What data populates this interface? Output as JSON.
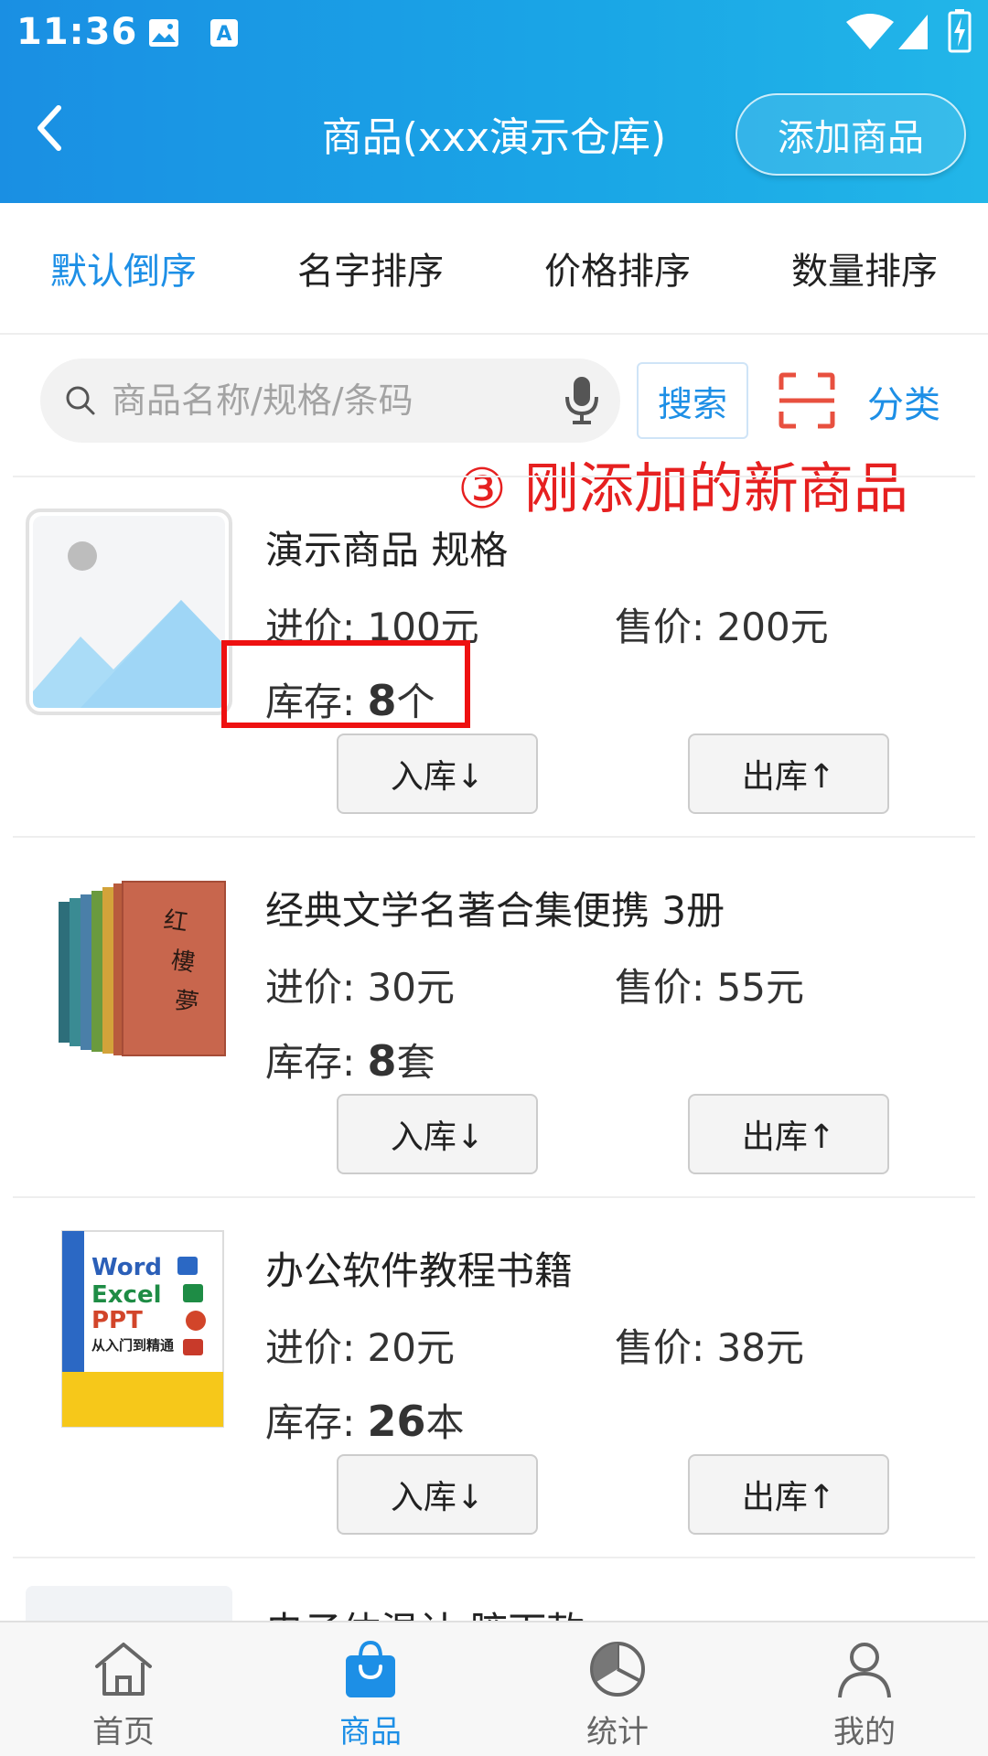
{
  "status_bar": {
    "time": "11:36"
  },
  "header": {
    "title": "商品(xxx演示仓库)",
    "add_button": "添加商品"
  },
  "sort_tabs": [
    {
      "label": "默认倒序",
      "active": true
    },
    {
      "label": "名字排序",
      "active": false
    },
    {
      "label": "价格排序",
      "active": false
    },
    {
      "label": "数量排序",
      "active": false
    }
  ],
  "search": {
    "placeholder": "商品名称/规格/条码",
    "button": "搜索",
    "category": "分类"
  },
  "annotation": "③ 刚添加的新商品",
  "products": [
    {
      "name": "演示商品  规格",
      "cost": "进价: 100元",
      "sale": "售价: 200元",
      "stock_label": "库存: ",
      "stock_qty": "8",
      "stock_unit": "个",
      "in_button": "入库↓",
      "out_button": "出库↑",
      "image": "placeholder-image"
    },
    {
      "name": "经典文学名著合集便携  3册",
      "cost": "进价: 30元",
      "sale": "售价: 55元",
      "stock_label": "库存: ",
      "stock_qty": "8",
      "stock_unit": "套",
      "in_button": "入库↓",
      "out_button": "出库↑",
      "image": "book-set-image"
    },
    {
      "name": "办公软件教程书籍",
      "cost": "进价: 20元",
      "sale": "售价: 38元",
      "stock_label": "库存: ",
      "stock_qty": "26",
      "stock_unit": "本",
      "in_button": "入库↓",
      "out_button": "出库↑",
      "image": "office-book-image",
      "cover_lines": [
        "Word",
        "Excel",
        "PPT",
        "从入门到精通"
      ]
    },
    {
      "name": "电子体温计  腋下款",
      "image": "thermometer-image"
    }
  ],
  "bottom_nav": [
    {
      "label": "首页",
      "icon": "home-icon",
      "active": false
    },
    {
      "label": "商品",
      "icon": "shopping-bag-icon",
      "active": true
    },
    {
      "label": "统计",
      "icon": "pie-chart-icon",
      "active": false
    },
    {
      "label": "我的",
      "icon": "user-icon",
      "active": false
    }
  ],
  "colors": {
    "header": "#1a9be5",
    "accent": "#1d8fe6",
    "annotation": "#e62020"
  }
}
